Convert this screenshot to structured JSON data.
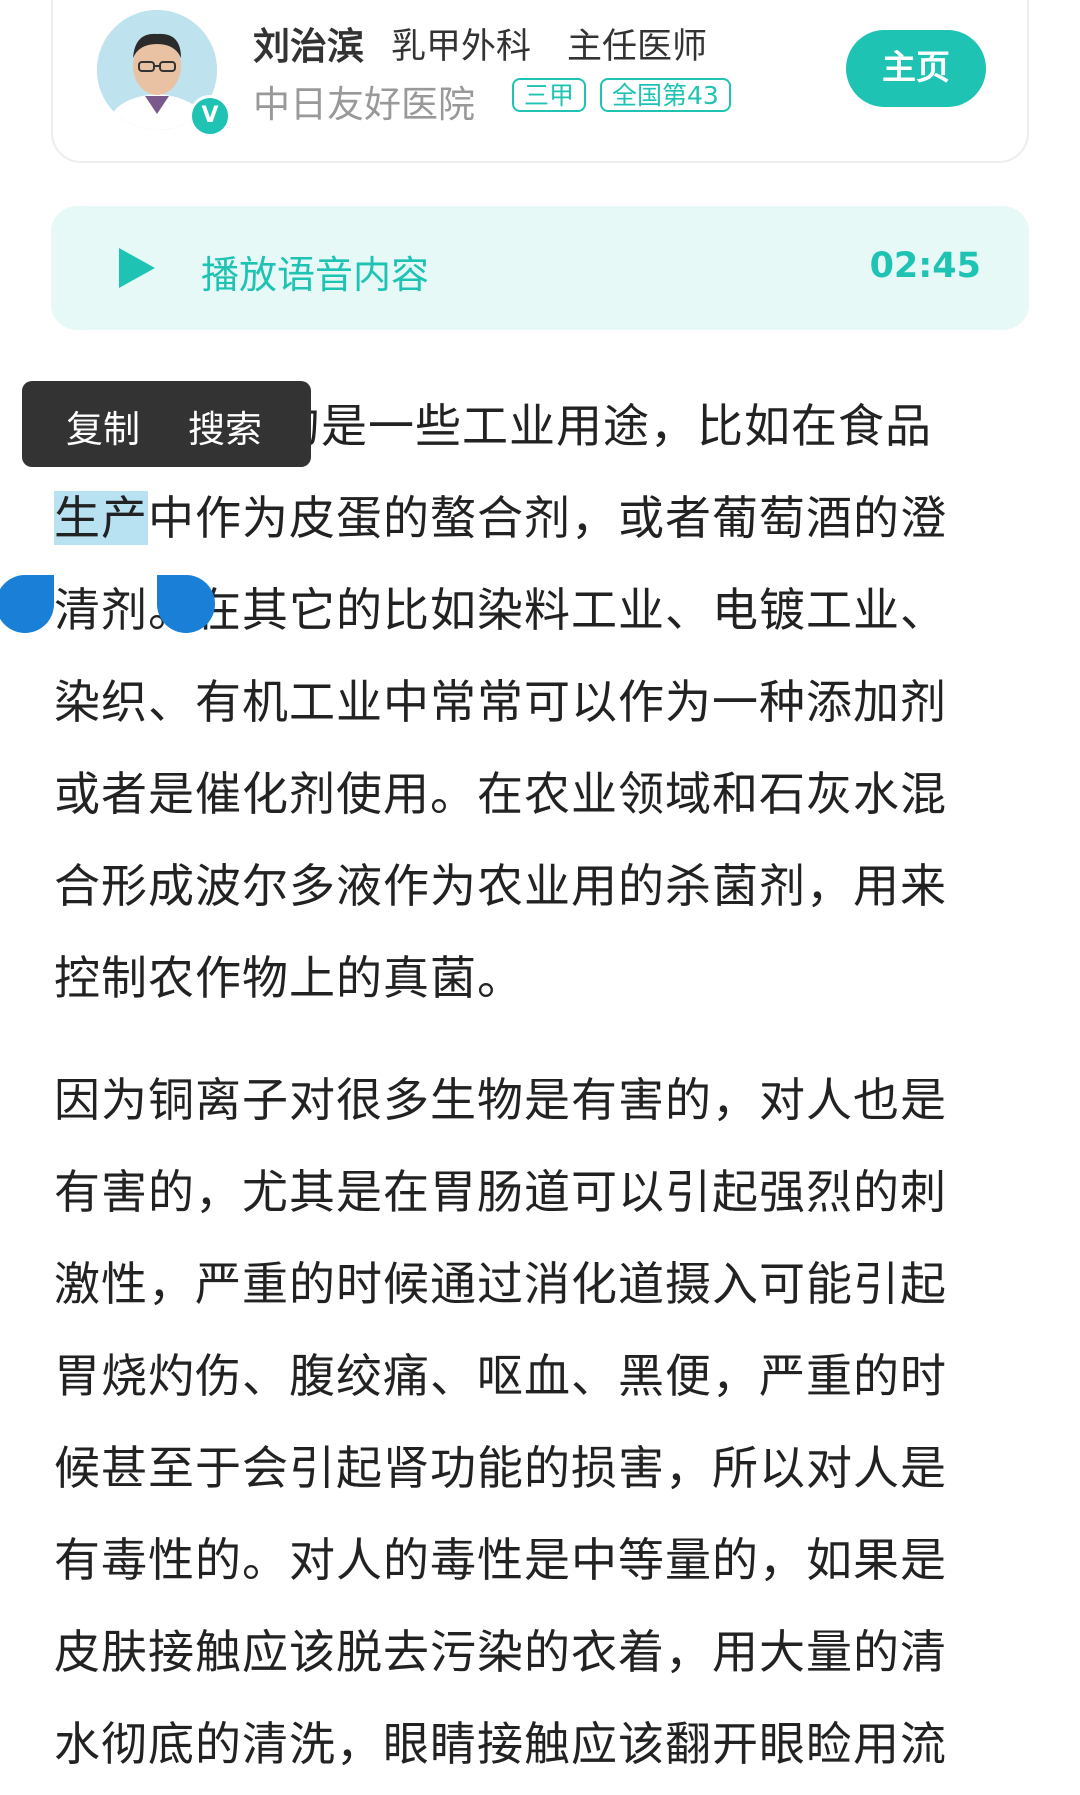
{
  "doctor": {
    "name": "刘治滨",
    "department": "乳甲外科",
    "title": "主任医师",
    "hospital": "中日友好医院",
    "tags": [
      "三甲",
      "全国第43"
    ],
    "home_button": "主页",
    "verified_badge": "V"
  },
  "audio": {
    "label": "播放语音内容",
    "duration": "02:45"
  },
  "context_menu": {
    "copy": "复制",
    "search": "搜索"
  },
  "selection": {
    "text": "生产"
  },
  "article": {
    "paragraph1": [
      "的是一些工业用途，比如在食品",
      "中作为皮蛋的螯合剂，或者葡萄酒的澄",
      "清剂。在其它的比如染料工业、电镀工业、",
      "染织、有机工业中常常可以作为一种添加剂",
      "或者是催化剂使用。在农业领域和石灰水混",
      "合形成波尔多液作为农业用的杀菌剂，用来",
      "控制农作物上的真菌。"
    ],
    "paragraph2": [
      "因为铜离子对很多生物是有害的，对人也是",
      "有害的，尤其是在胃肠道可以引起强烈的刺",
      "激性，严重的时候通过消化道摄入可能引起",
      "胃烧灼伤、腹绞痛、呕血、黑便，严重的时",
      "候甚至于会引起肾功能的损害，所以对人是",
      "有毒性的。对人的毒性是中等量的，如果是",
      "皮肤接触应该脱去污染的衣着，用大量的清",
      "水彻底的清洗，眼睛接触应该翻开眼睑用流"
    ]
  },
  "colors": {
    "accent": "#1ec3b3",
    "audio_bg": "#e6f9f7",
    "selection": "#b8e1f2",
    "handle": "#1a7fd6",
    "menu_bg": "#333333"
  }
}
